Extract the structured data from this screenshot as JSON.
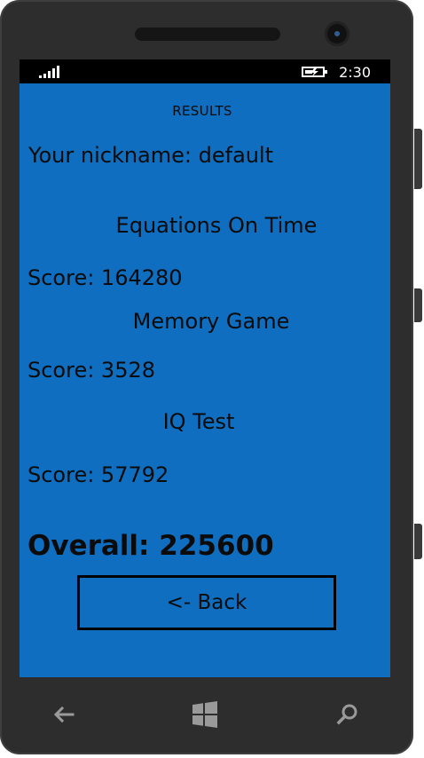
{
  "status_bar": {
    "time": "2:30",
    "signal_icon": "signal-bars-icon",
    "battery_icon": "battery-charging-icon"
  },
  "page": {
    "title": "RESULTS",
    "nickname": "Your nickname: default"
  },
  "sections": [
    {
      "title": "Equations On Time",
      "score": "Score: 164280"
    },
    {
      "title": "Memory Game",
      "score": "Score: 3528"
    },
    {
      "title": "IQ Test",
      "score": "Score: 57792"
    }
  ],
  "overall": "Overall: 225600",
  "back_button": {
    "label": "<- Back"
  },
  "navigation": {
    "back_icon": "back-arrow-icon",
    "home_icon": "windows-logo-icon",
    "search_icon": "search-icon"
  },
  "colors": {
    "screen_background": "#0f6ebf",
    "device_frame": "#2d2d2d",
    "text": "#0b0b0b"
  }
}
